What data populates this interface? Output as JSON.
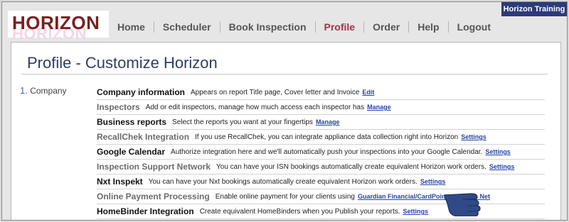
{
  "brand": {
    "logo_text": "HORIZON",
    "logo_ghost_text": "HORIZON"
  },
  "training_badge": "Horizon Training",
  "nav": {
    "items": [
      {
        "label": "Home"
      },
      {
        "label": "Scheduler"
      },
      {
        "label": "Book Inspection"
      },
      {
        "label": "Profile",
        "active": true
      },
      {
        "label": "Order"
      },
      {
        "label": "Help"
      },
      {
        "label": "Logout"
      }
    ]
  },
  "page_title": "Profile - Customize Horizon",
  "step": {
    "number": "1.",
    "label": "Company"
  },
  "settings_rows": [
    {
      "name": "Company information",
      "description": "Appears on report Title page, Cover letter and Invoice",
      "link": "Edit",
      "tone": "dark"
    },
    {
      "name": "Inspectors",
      "description": "Add or edit inspectors, manage how much access each inspector has",
      "link": "Manage",
      "tone": "gray"
    },
    {
      "name": "Business reports",
      "description": "Select the reports you want at your fingertips",
      "link": "Manage",
      "tone": "dark"
    },
    {
      "name": "RecallChek Integration",
      "description": "If you use RecallChek, you can integrate appliance data collection right into Horizon",
      "link": "Settings",
      "tone": "gray"
    },
    {
      "name": "Google Calendar",
      "description": "Authorize integration here and we'll automatically push your inspections into your Google Calendar.",
      "link": "Settings",
      "tone": "dark"
    },
    {
      "name": "Inspection Support Network",
      "description": "You can have your ISN bookings automatically create equivalent Horizon work orders.",
      "link": "Settings",
      "tone": "gray"
    },
    {
      "name": "Nxt Inspekt",
      "description": "You can have your Nxt bookings automatically create equivalent Horizon work orders.",
      "link": "Settings",
      "tone": "dark"
    },
    {
      "name": "Online Payment Processing",
      "description": "Enable online payment for your clients using",
      "link": "Guardian Financial/CardPointe                Net",
      "tone": "gray"
    },
    {
      "name": "HomeBinder Integration",
      "description": "Create equivalent HomeBinders when you Publish your reports.",
      "link": "Settings",
      "tone": "dark"
    }
  ],
  "colors": {
    "nav_active": "#a0344a",
    "badge_bg": "#2c3a78",
    "link": "#2545a8",
    "title": "#2e3e63",
    "hand": "#2f4a86"
  },
  "icons": {
    "pointer": "pointing-hand-icon"
  }
}
